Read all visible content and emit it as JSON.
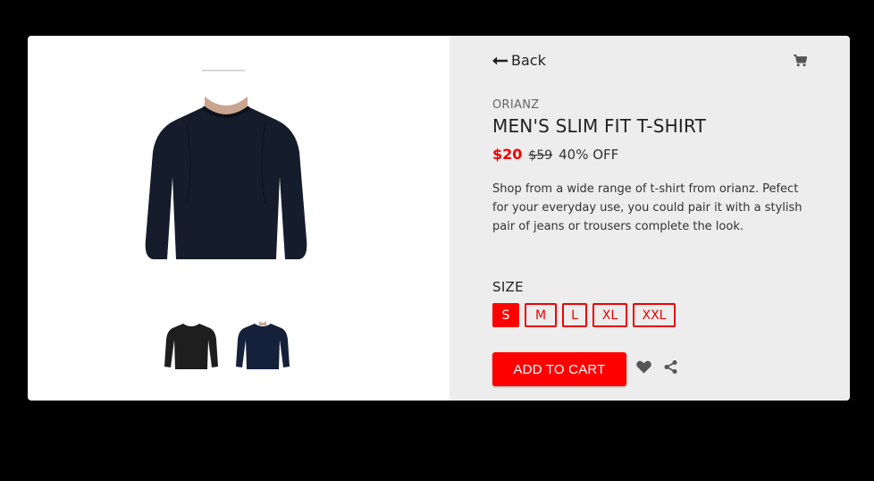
{
  "product": {
    "back_label": "Back",
    "brand": "ORIANZ",
    "title": "MEN'S SLIM FIT T-SHIRT",
    "price": "$20",
    "old_price": "$59",
    "discount": "40% OFF",
    "description": "Shop from a wide range of t-shirt from orianz. Pefect for your everyday use, you could pair it with a stylish pair of jeans or trousers complete the look.",
    "size_label": "SIZE",
    "sizes": [
      "S",
      "M",
      "L",
      "XL",
      "XXL"
    ],
    "selected_size": "S",
    "add_to_cart_label": "ADD TO CART"
  },
  "icons": {
    "back": "arrow-left-icon",
    "cart": "cart-icon",
    "wishlist": "heart-icon",
    "share": "share-icon"
  },
  "colors": {
    "accent": "#ff0000",
    "price": "#e00000",
    "panel_bg": "#ededed",
    "icon": "#555555"
  }
}
